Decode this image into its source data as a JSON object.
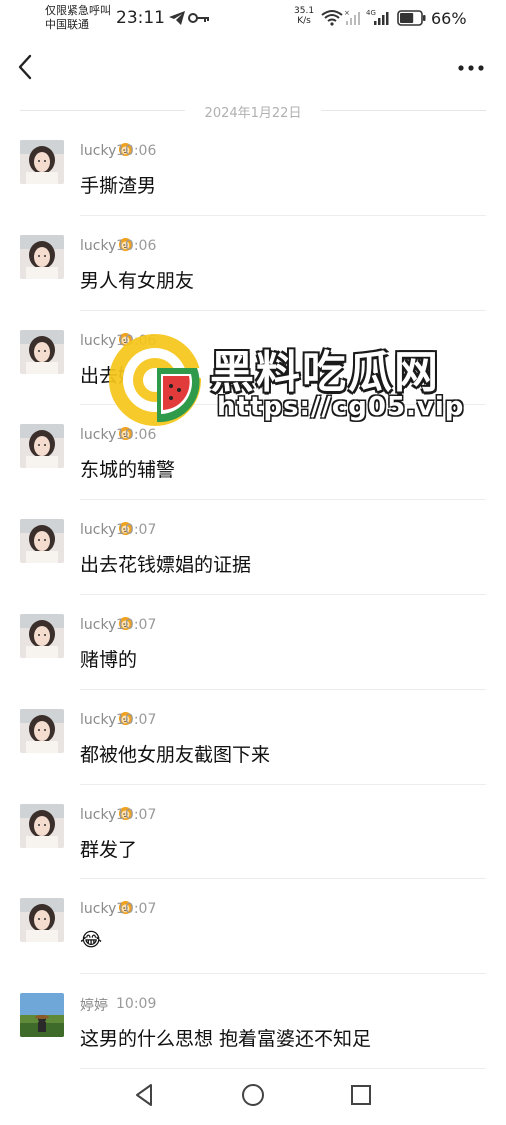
{
  "status_bar": {
    "carrier_line1": "仅限紧急呼叫",
    "carrier_line2": "中国联通",
    "time": "23:11",
    "net_speed_value": "35.1",
    "net_speed_unit": "K/s",
    "signal_label": "4G",
    "battery_percent": "66%",
    "battery_level": 0.66,
    "icons": [
      "telegram-icon",
      "key-icon",
      "wifi-icon",
      "signal-icon",
      "battery-icon"
    ]
  },
  "header": {
    "back_icon": "chevron-left-icon",
    "more_icon": "more-horizontal-icon"
  },
  "date_divider": "2024年1月22日",
  "messages": [
    {
      "sender": "lucky",
      "time": "10:06",
      "text": "手撕渣男"
    },
    {
      "sender": "lucky",
      "time": "10:06",
      "text": "男人有女朋友"
    },
    {
      "sender": "lucky",
      "time": "10:06",
      "text": "出去嫖"
    },
    {
      "sender": "lucky",
      "time": "10:06",
      "text": "东城的辅警"
    },
    {
      "sender": "lucky",
      "time": "10:07",
      "text": "出去花钱嫖娼的证据"
    },
    {
      "sender": "lucky",
      "time": "10:07",
      "text": "赌博的"
    },
    {
      "sender": "lucky",
      "time": "10:07",
      "text": "都被他女朋友截图下来"
    },
    {
      "sender": "lucky",
      "time": "10:07",
      "text": "群发了"
    },
    {
      "sender": "lucky",
      "time": "10:07",
      "text": "😂"
    },
    {
      "sender": "婷婷",
      "time": "10:09",
      "text": "这男的什么思想 抱着富婆还不知足"
    }
  ],
  "watermark": {
    "title": "黑料吃瓜网",
    "url": "https://cg05.vip"
  },
  "nav_bar": [
    "back-triangle-icon",
    "home-circle-icon",
    "recents-square-icon"
  ],
  "colors": {
    "accent_yellow": "#f5c518",
    "badge_orange": "#f0a21e",
    "separator": "#ededed",
    "meta_text": "#9a9a9a"
  }
}
